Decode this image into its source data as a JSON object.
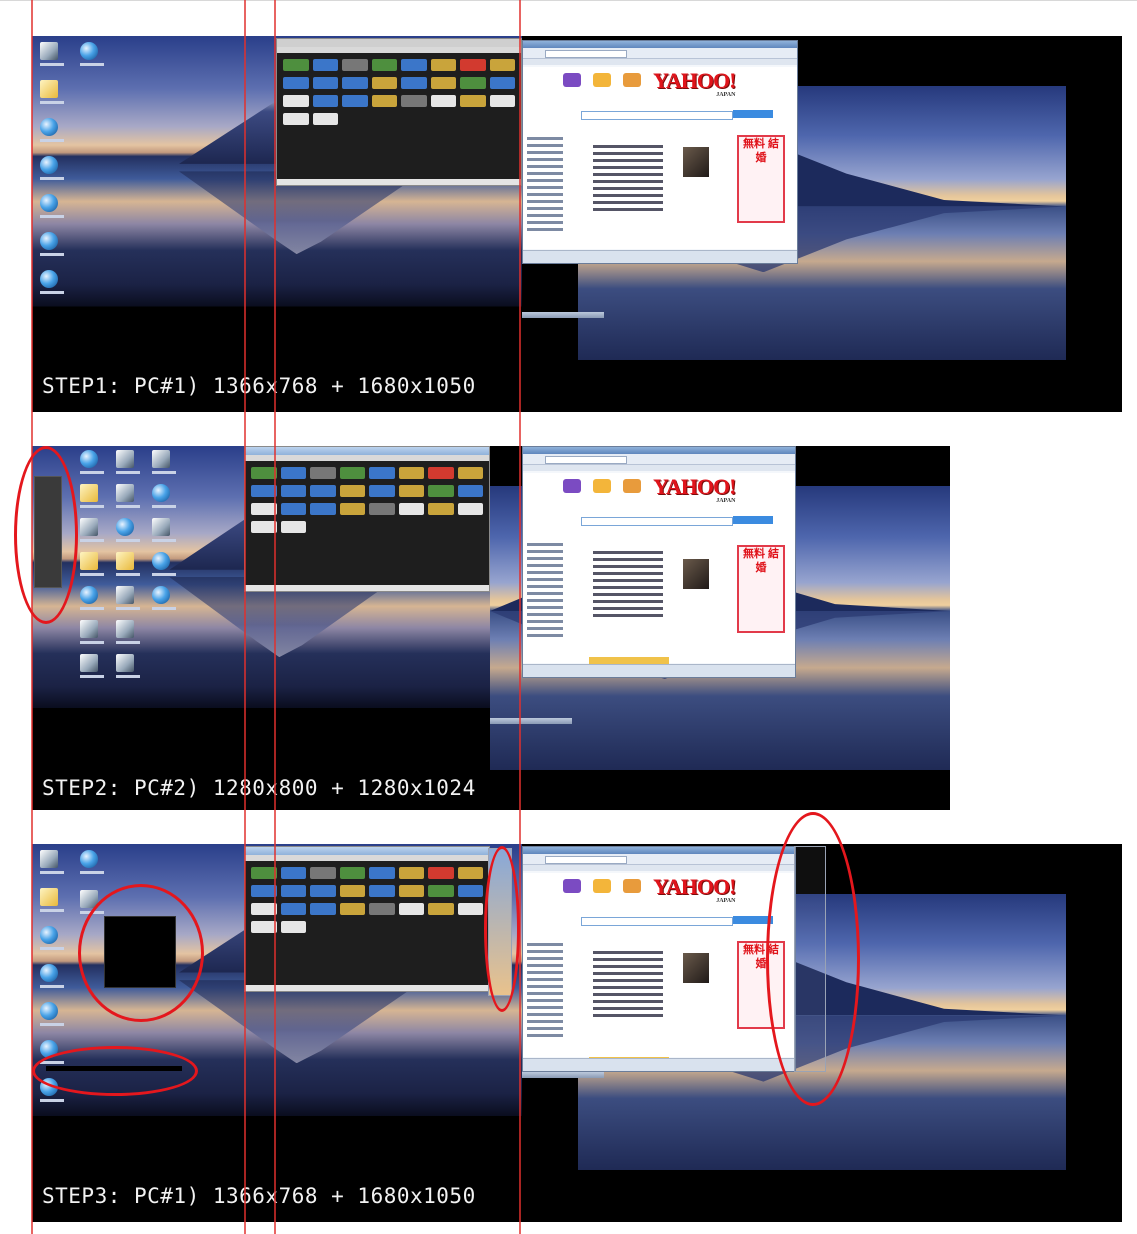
{
  "steps": [
    {
      "caption": "STEP1: PC#1) 1366x768 + 1680x1050"
    },
    {
      "caption": "STEP2: PC#2) 1280x800 + 1280x1024"
    },
    {
      "caption": "STEP3: PC#1) 1366x768 + 1680x1050"
    }
  ],
  "browser": {
    "brand": "YAHOO!",
    "brand_sub": "JAPAN",
    "ad_text": "無料 結婚"
  },
  "colors": {
    "annotation": "#e4171d",
    "guide_line": "#e0302e"
  }
}
